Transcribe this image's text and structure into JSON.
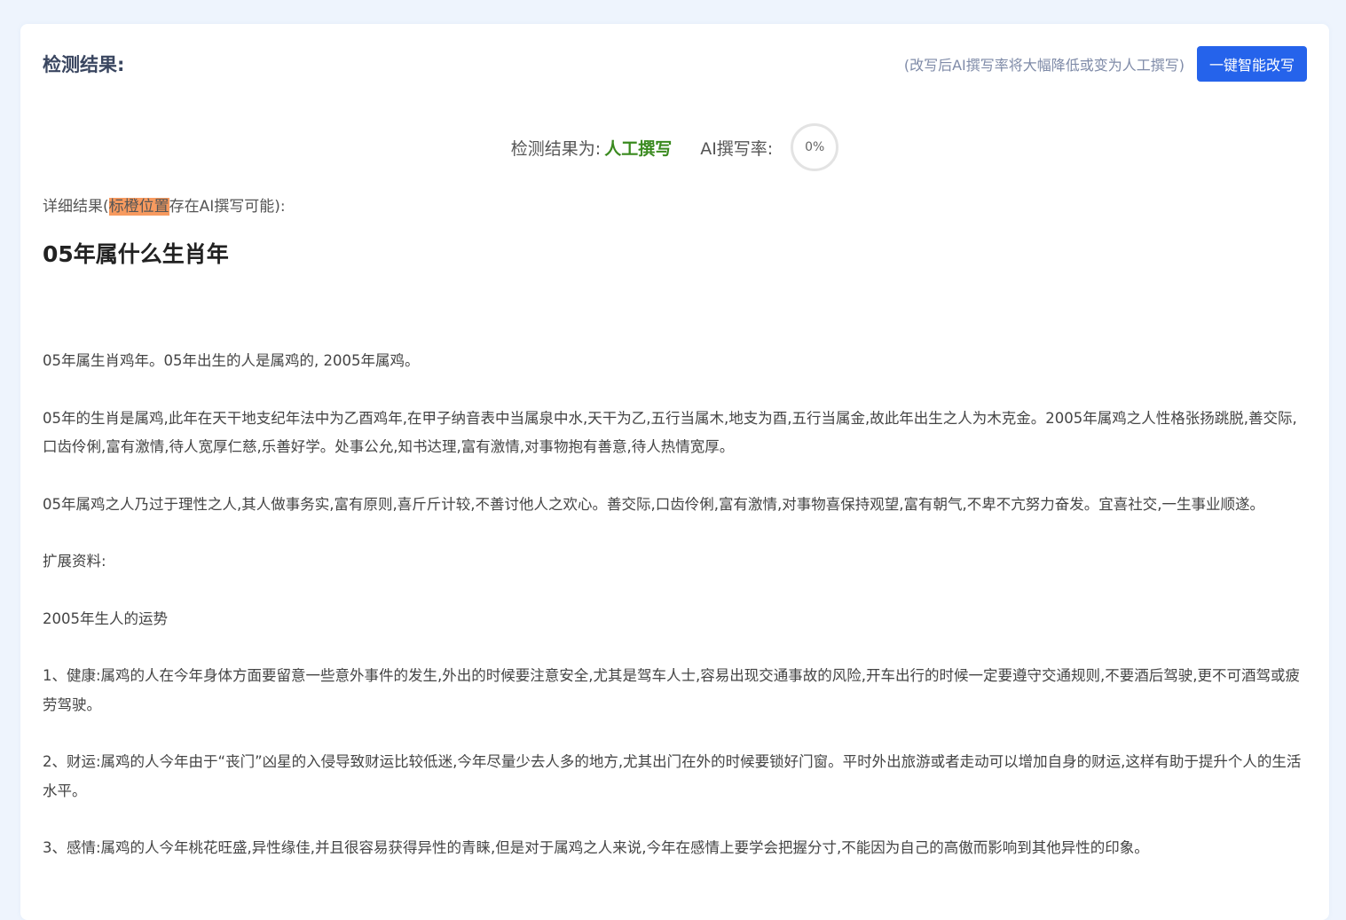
{
  "header": {
    "title": "检测结果:",
    "hint": "(改写后AI撰写率将大幅降低或变为人工撰写)",
    "rewrite_button": "一键智能改写"
  },
  "result": {
    "label": "检测结果为:",
    "value": "人工撰写",
    "rate_label": "AI撰写率:",
    "rate_value": "0%"
  },
  "detail": {
    "prefix": "详细结果(",
    "highlight": "标橙位置",
    "suffix": "存在AI撰写可能):"
  },
  "colors": {
    "accent": "#2563eb",
    "result_green": "#3a8a1f",
    "highlight_orange": "#f79a5f"
  },
  "article": {
    "title": "05年属什么生肖年",
    "paragraphs": [
      "05年属生肖鸡年。05年出生的人是属鸡的, 2005年属鸡。",
      "05年的生肖是属鸡,此年在天干地支纪年法中为乙酉鸡年,在甲子纳音表中当属泉中水,天干为乙,五行当属木,地支为酉,五行当属金,故此年出生之人为木克金。2005年属鸡之人性格张扬跳脱,善交际,口齿伶俐,富有激情,待人宽厚仁慈,乐善好学。处事公允,知书达理,富有激情,对事物抱有善意,待人热情宽厚。",
      "05年属鸡之人乃过于理性之人,其人做事务实,富有原则,喜斤斤计较,不善讨他人之欢心。善交际,口齿伶俐,富有激情,对事物喜保持观望,富有朝气,不卑不亢努力奋发。宜喜社交,一生事业顺遂。",
      "扩展资料:",
      "2005年生人的运势",
      "1、健康:属鸡的人在今年身体方面要留意一些意外事件的发生,外出的时候要注意安全,尤其是驾车人士,容易出现交通事故的风险,开车出行的时候一定要遵守交通规则,不要酒后驾驶,更不可酒驾或疲劳驾驶。",
      "2、财运:属鸡的人今年由于“丧门”凶星的入侵导致财运比较低迷,今年尽量少去人多的地方,尤其出门在外的时候要锁好门窗。平时外出旅游或者走动可以增加自身的财运,这样有助于提升个人的生活水平。",
      "3、感情:属鸡的人今年桃花旺盛,异性缘佳,并且很容易获得异性的青睐,但是对于属鸡之人来说,今年在感情上要学会把握分寸,不能因为自己的高傲而影响到其他异性的印象。"
    ]
  }
}
